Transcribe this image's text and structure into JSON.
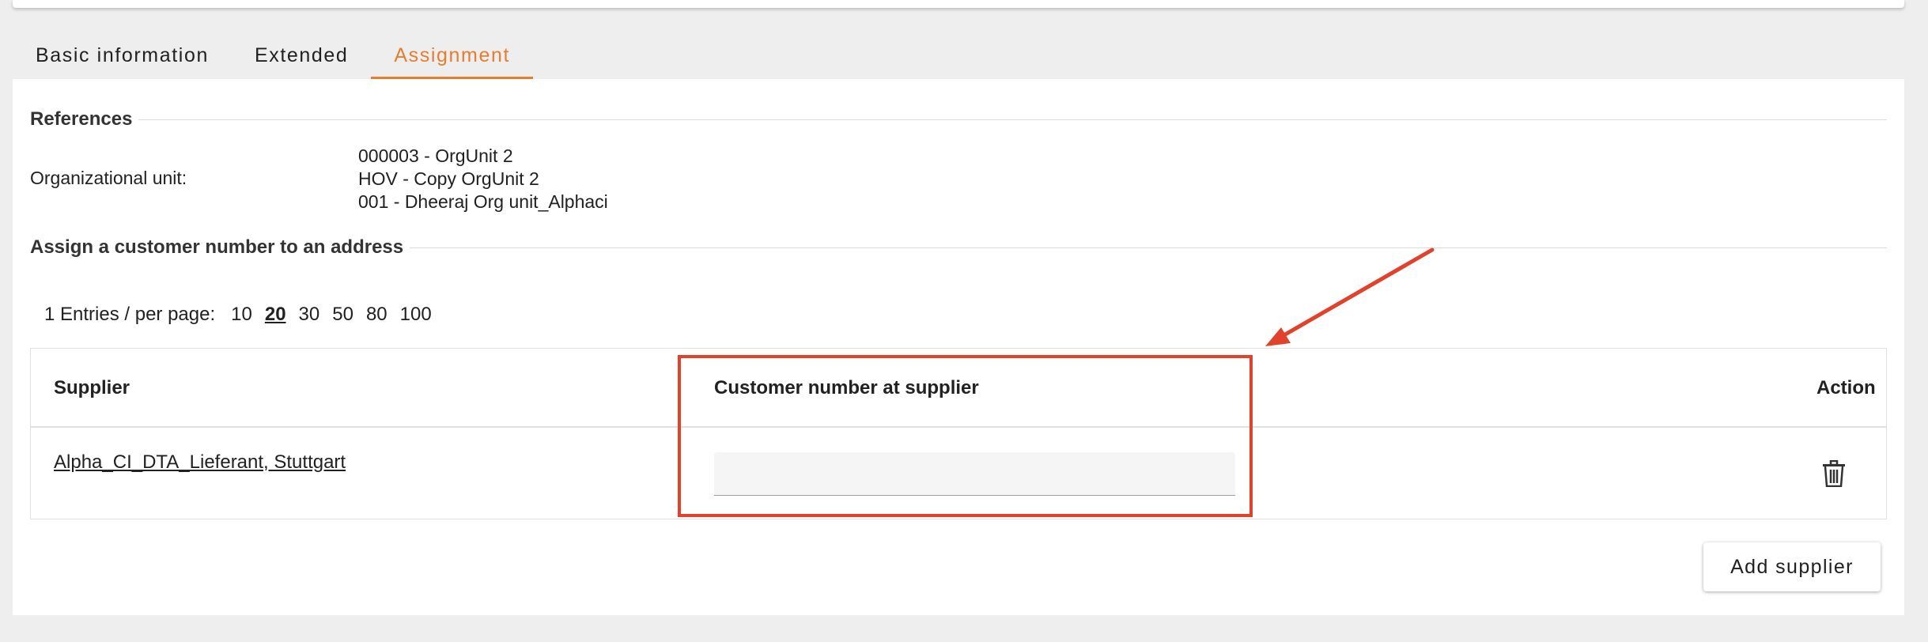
{
  "tabs": [
    {
      "label": "Basic information",
      "active": false
    },
    {
      "label": "Extended",
      "active": false
    },
    {
      "label": "Assignment",
      "active": true
    }
  ],
  "references": {
    "title": "References",
    "org_unit_label": "Organizational unit:",
    "org_units": [
      "000003 - OrgUnit 2",
      "HOV - Copy OrgUnit 2",
      "001 - Dheeraj Org unit_Alphaci"
    ]
  },
  "assign": {
    "title": "Assign a customer number to an address"
  },
  "pagination": {
    "count_text": "1 Entries / per page:",
    "options": [
      "10",
      "20",
      "30",
      "50",
      "80",
      "100"
    ],
    "selected": "20"
  },
  "table": {
    "headers": {
      "supplier": "Supplier",
      "customer_number": "Customer number at supplier",
      "action": "Action"
    },
    "rows": [
      {
        "supplier": "Alpha_CI_DTA_Lieferant, Stuttgart",
        "customer_number": ""
      }
    ]
  },
  "add_supplier_label": "Add supplier",
  "icons": {
    "delete": "trash-icon"
  },
  "colors": {
    "accent": "#e87d2e",
    "annotation": "#e2422b",
    "background": "#eeeeee",
    "panel": "#ffffff"
  }
}
